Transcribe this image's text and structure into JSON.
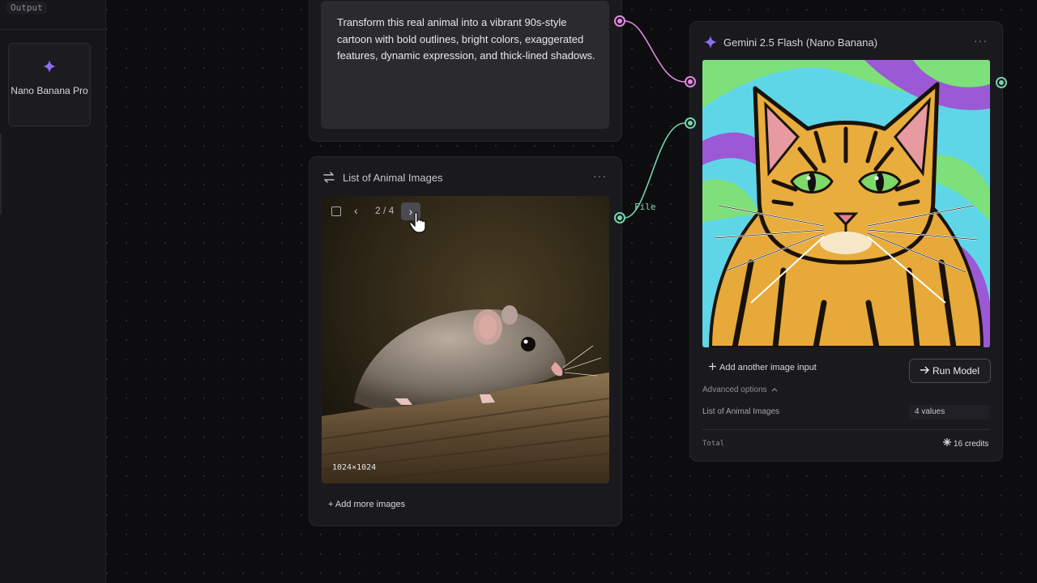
{
  "sidebar": {
    "output_tag": "Output",
    "model_card": {
      "name": "Nano Banana Pro",
      "icon": "sparkle-icon"
    }
  },
  "prompt_node": {
    "text": "Transform this real animal into a vibrant 90s-style cartoon with bold outlines, bright colors, exaggerated features, dynamic expression, and thick-lined shadows."
  },
  "list_node": {
    "title": "List of Animal Images",
    "menu": "···",
    "counter": "2 / 4",
    "prev": "‹",
    "next": "›",
    "image_dimensions": "1024×1024",
    "add_more": "+ Add more images"
  },
  "edge_labels": {
    "file": "File"
  },
  "gemini_node": {
    "title": "Gemini 2.5 Flash (Nano Banana)",
    "menu": "···",
    "add_input": "Add another image input",
    "run_button": "Run Model",
    "advanced_options": "Advanced options",
    "input_row": {
      "label": "List of Animal Images",
      "value": "4 values"
    },
    "total_label": "Total",
    "credits": "16 credits"
  },
  "colors": {
    "accent_pink": "#e08adf",
    "accent_green": "#74d3ac",
    "accent_purple": "#8b6ff0"
  }
}
